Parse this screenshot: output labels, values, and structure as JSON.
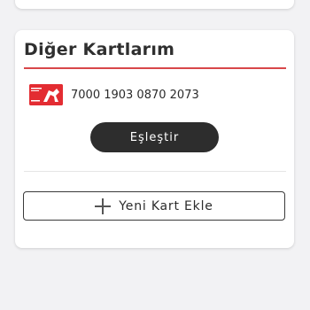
{
  "other_cards": {
    "title": "Diğer Kartlarım",
    "cards": [
      {
        "number": "7000 1903 0870 2073",
        "logo_color": "#e32c32"
      }
    ],
    "pair_button_label": "Eşleştir",
    "add_card_label": "Yeni Kart Ekle"
  },
  "colors": {
    "accent_rule": "#d8474a",
    "button_dark": "#2d2d2d",
    "background": "#f2f2f4"
  }
}
